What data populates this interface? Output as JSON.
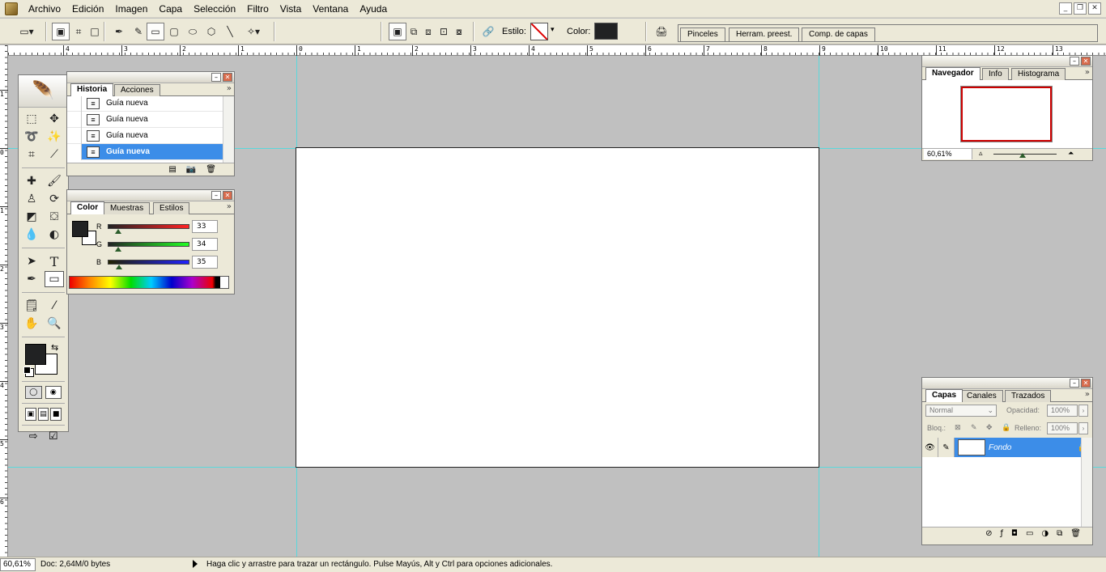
{
  "menu": {
    "items": [
      "Archivo",
      "Edición",
      "Imagen",
      "Capa",
      "Selección",
      "Filtro",
      "Vista",
      "Ventana",
      "Ayuda"
    ]
  },
  "options_bar": {
    "style_label": "Estilo:",
    "color_label": "Color:",
    "color_value": "#212223",
    "palette_well_tabs": [
      "Pinceles",
      "Herram. preest.",
      "Comp. de capas"
    ]
  },
  "rulers": {
    "horizontal_labels": [
      "4",
      "3",
      "2",
      "1",
      "0",
      "1",
      "2",
      "3",
      "4",
      "5",
      "6",
      "7",
      "8",
      "9",
      "10",
      "11",
      "12",
      "13"
    ],
    "vertical_labels": [
      "1",
      "0",
      "1",
      "2",
      "3",
      "4",
      "5",
      "6"
    ]
  },
  "history_panel": {
    "tabs": [
      "Historia",
      "Acciones"
    ],
    "items": [
      "Guía nueva",
      "Guía nueva",
      "Guía nueva",
      "Guía nueva"
    ],
    "selected_index": 3
  },
  "color_panel": {
    "tabs": [
      "Color",
      "Muestras",
      "Estilos"
    ],
    "foreground": "#212223",
    "background": "#ffffff",
    "channels": [
      {
        "label": "R",
        "value": "33"
      },
      {
        "label": "G",
        "value": "34"
      },
      {
        "label": "B",
        "value": "35"
      }
    ]
  },
  "navigator_panel": {
    "tabs": [
      "Navegador",
      "Info",
      "Histograma"
    ],
    "zoom": "60,61%"
  },
  "layers_panel": {
    "tabs": [
      "Capas",
      "Canales",
      "Trazados"
    ],
    "blend_mode": "Normal",
    "opacity_label": "Opacidad:",
    "opacity_value": "100%",
    "lock_label": "Bloq.:",
    "fill_label": "Relleno:",
    "fill_value": "100%",
    "layers": [
      {
        "name": "Fondo"
      }
    ]
  },
  "toolbox": {
    "foreground": "#212223",
    "background": "#ffffff"
  },
  "status_bar": {
    "zoom": "60,61%",
    "doc_info": "Doc: 2,64M/0 bytes",
    "hint": "Haga clic y arrastre para trazar un rectángulo. Pulse Mayús, Alt y Ctrl para opciones adicionales."
  }
}
